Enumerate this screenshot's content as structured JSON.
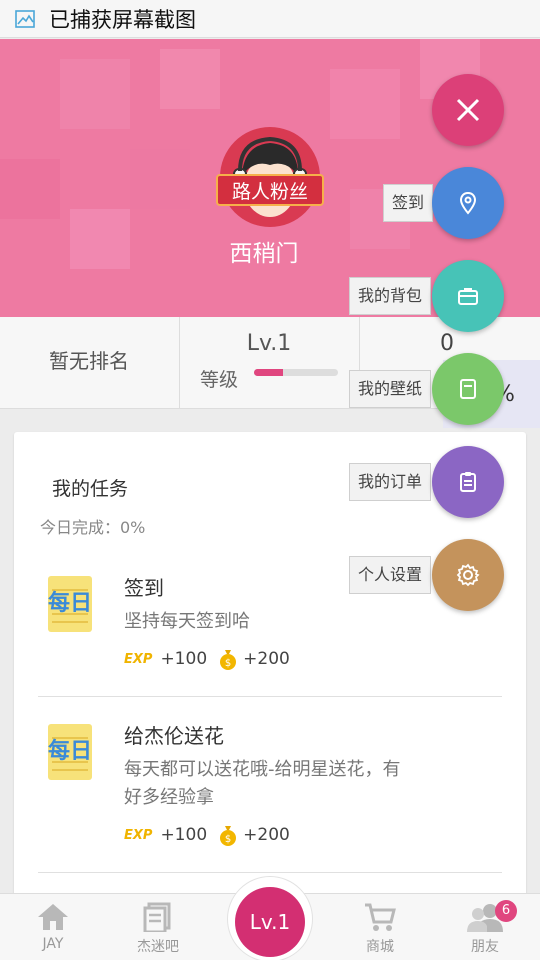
{
  "statusbar": {
    "title": "已捕获屏幕截图",
    "icon": "screenshot-icon"
  },
  "profile": {
    "badge": "路人粉丝",
    "username": "西稍门"
  },
  "stats": {
    "rank": "暂无排名",
    "level": "Lv.1",
    "level_label": "等级",
    "level_progress": 0.35,
    "count": "0",
    "percent": "76%"
  },
  "tasks": {
    "title": "我的任务",
    "completion": "今日完成：0%",
    "items": [
      {
        "icon_text": "每日",
        "name": "签到",
        "desc": "坚持每天签到哈",
        "exp": "+100",
        "coins": "+200"
      },
      {
        "icon_text": "每日",
        "name": "给杰伦送花",
        "desc": "每天都可以送花哦-给明星送花，有好多经验拿",
        "exp": "+100",
        "coins": "+200"
      }
    ]
  },
  "fab": {
    "close": "close-icon",
    "items": [
      {
        "label": "签到",
        "icon": "location-pin-icon",
        "color": "#4a87d9"
      },
      {
        "label": "我的背包",
        "icon": "briefcase-icon",
        "color": "#47c3b7"
      },
      {
        "label": "我的壁纸",
        "icon": "wallpaper-icon",
        "color": "#7bc86a"
      },
      {
        "label": "我的订单",
        "icon": "clipboard-icon",
        "color": "#8b66c4"
      },
      {
        "label": "个人设置",
        "icon": "gear-icon",
        "color": "#c4935c"
      }
    ],
    "close_color": "#dc4078"
  },
  "nav": {
    "items": [
      {
        "label": "JAY",
        "icon": "home-icon"
      },
      {
        "label": "杰迷吧",
        "icon": "forum-icon"
      },
      {
        "label": "商城",
        "icon": "cart-icon"
      },
      {
        "label": "朋友",
        "icon": "friends-icon"
      }
    ],
    "center": "Lv.1",
    "badge_count": "6"
  }
}
